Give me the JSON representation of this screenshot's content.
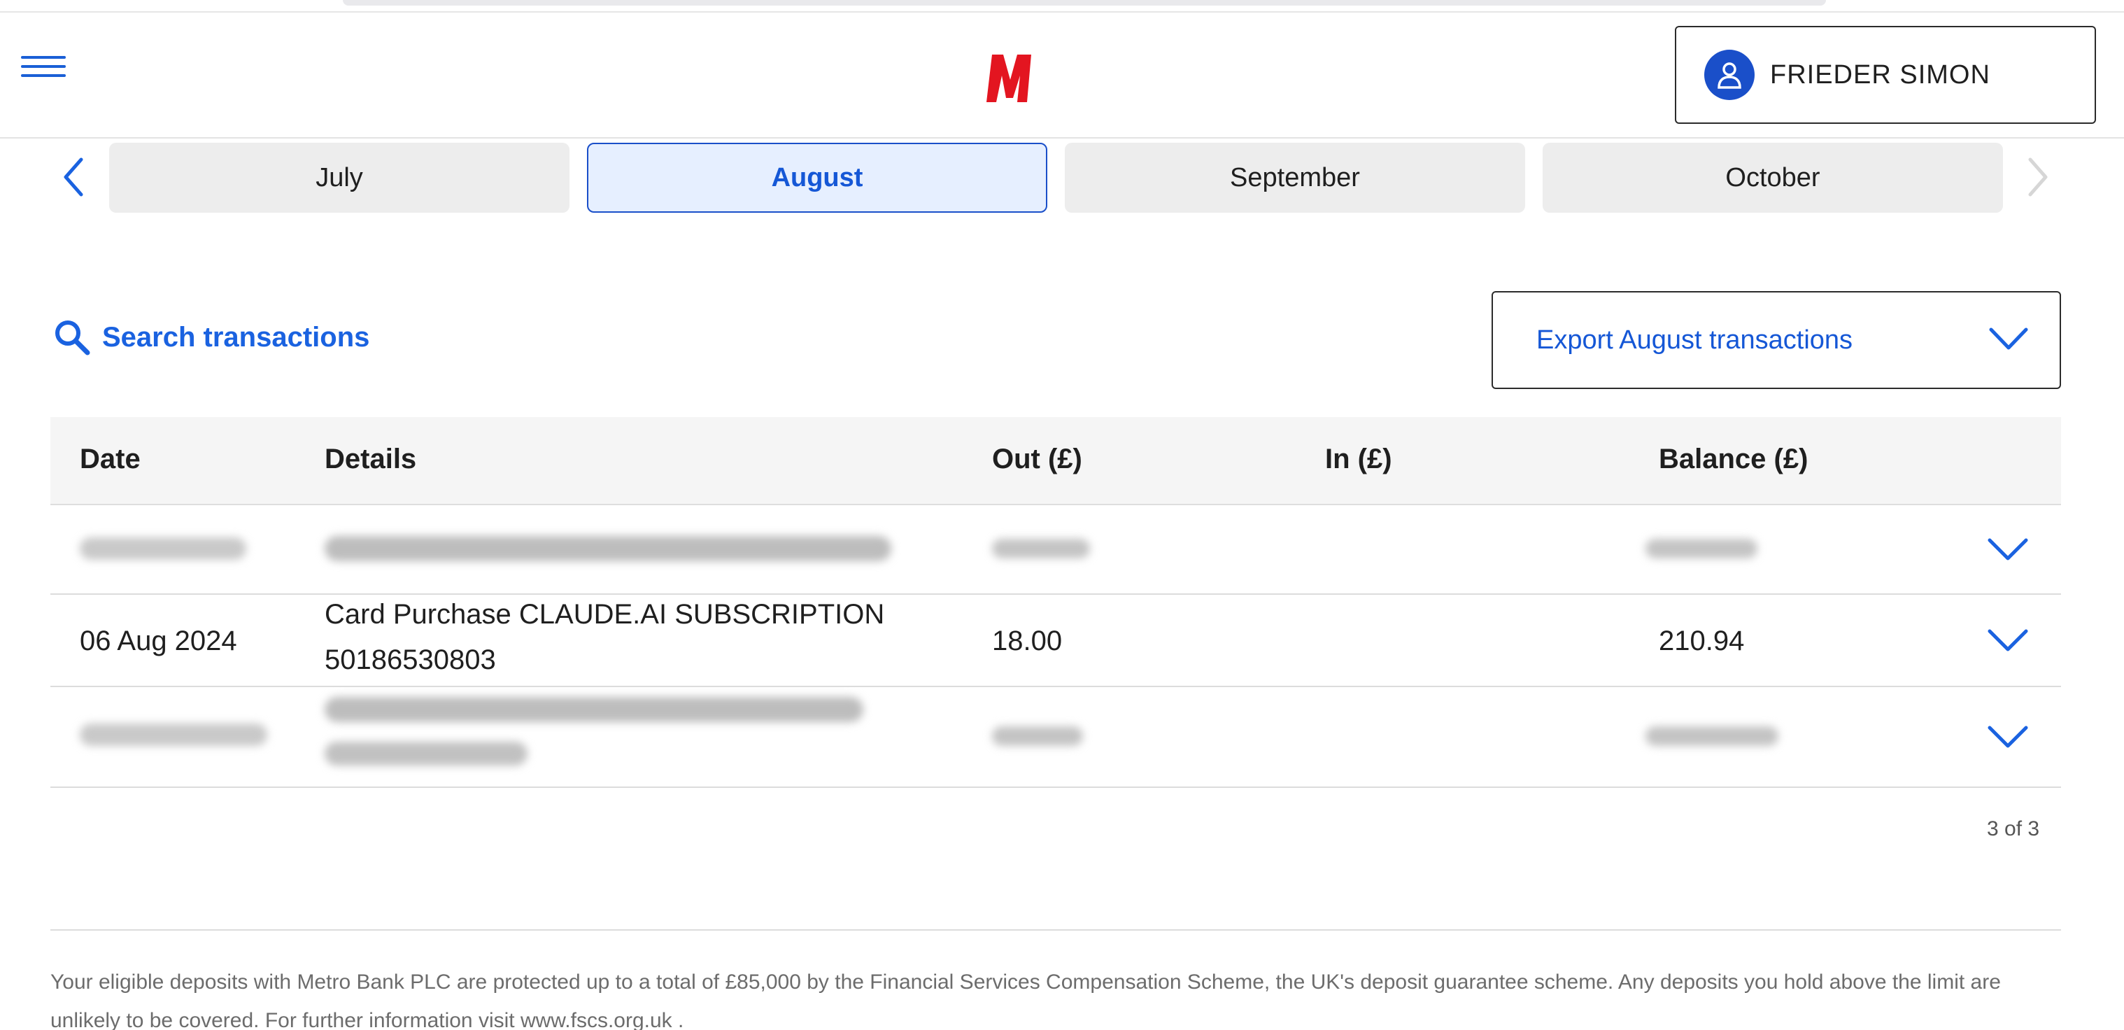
{
  "header": {
    "logo_letter": "M",
    "user_name": "FRIEDER SIMON",
    "brand_color": "#e31520"
  },
  "months": {
    "tabs": [
      {
        "label": "July",
        "active": false
      },
      {
        "label": "August",
        "active": true
      },
      {
        "label": "September",
        "active": false
      },
      {
        "label": "October",
        "active": false
      }
    ]
  },
  "toolbar": {
    "search_label": "Search transactions",
    "export_label": "Export August transactions"
  },
  "table": {
    "columns": [
      "Date",
      "Details",
      "Out (£)",
      "In (£)",
      "Balance (£)"
    ],
    "rows": [
      {
        "date": "06 Aug 2024",
        "details_line1": "Card Purchase CLAUDE.AI SUBSCRIPTION",
        "details_line2": "50186530803",
        "out": "18.00",
        "in": "",
        "balance": "210.94"
      }
    ]
  },
  "pagination": {
    "text": "3 of 3"
  },
  "footer": {
    "text": "Your eligible deposits with Metro Bank PLC are protected up to a total of £85,000 by the Financial Services Compensation Scheme, the UK's deposit guarantee scheme. Any deposits you hold above the limit are unlikely to be covered. For further information visit www.fscs.org.uk ."
  }
}
